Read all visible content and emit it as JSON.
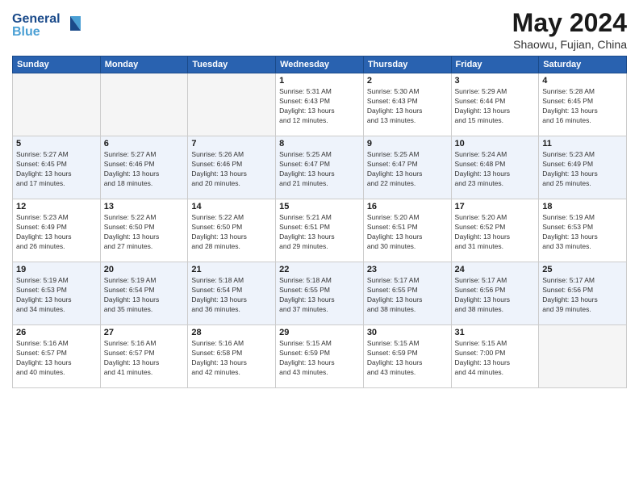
{
  "header": {
    "title": "May 2024",
    "location": "Shaowu, Fujian, China"
  },
  "calendar": {
    "headers": [
      "Sunday",
      "Monday",
      "Tuesday",
      "Wednesday",
      "Thursday",
      "Friday",
      "Saturday"
    ],
    "rows": [
      [
        {
          "day": "",
          "info": ""
        },
        {
          "day": "",
          "info": ""
        },
        {
          "day": "",
          "info": ""
        },
        {
          "day": "1",
          "info": "Sunrise: 5:31 AM\nSunset: 6:43 PM\nDaylight: 13 hours\nand 12 minutes."
        },
        {
          "day": "2",
          "info": "Sunrise: 5:30 AM\nSunset: 6:43 PM\nDaylight: 13 hours\nand 13 minutes."
        },
        {
          "day": "3",
          "info": "Sunrise: 5:29 AM\nSunset: 6:44 PM\nDaylight: 13 hours\nand 15 minutes."
        },
        {
          "day": "4",
          "info": "Sunrise: 5:28 AM\nSunset: 6:45 PM\nDaylight: 13 hours\nand 16 minutes."
        }
      ],
      [
        {
          "day": "5",
          "info": "Sunrise: 5:27 AM\nSunset: 6:45 PM\nDaylight: 13 hours\nand 17 minutes."
        },
        {
          "day": "6",
          "info": "Sunrise: 5:27 AM\nSunset: 6:46 PM\nDaylight: 13 hours\nand 18 minutes."
        },
        {
          "day": "7",
          "info": "Sunrise: 5:26 AM\nSunset: 6:46 PM\nDaylight: 13 hours\nand 20 minutes."
        },
        {
          "day": "8",
          "info": "Sunrise: 5:25 AM\nSunset: 6:47 PM\nDaylight: 13 hours\nand 21 minutes."
        },
        {
          "day": "9",
          "info": "Sunrise: 5:25 AM\nSunset: 6:47 PM\nDaylight: 13 hours\nand 22 minutes."
        },
        {
          "day": "10",
          "info": "Sunrise: 5:24 AM\nSunset: 6:48 PM\nDaylight: 13 hours\nand 23 minutes."
        },
        {
          "day": "11",
          "info": "Sunrise: 5:23 AM\nSunset: 6:49 PM\nDaylight: 13 hours\nand 25 minutes."
        }
      ],
      [
        {
          "day": "12",
          "info": "Sunrise: 5:23 AM\nSunset: 6:49 PM\nDaylight: 13 hours\nand 26 minutes."
        },
        {
          "day": "13",
          "info": "Sunrise: 5:22 AM\nSunset: 6:50 PM\nDaylight: 13 hours\nand 27 minutes."
        },
        {
          "day": "14",
          "info": "Sunrise: 5:22 AM\nSunset: 6:50 PM\nDaylight: 13 hours\nand 28 minutes."
        },
        {
          "day": "15",
          "info": "Sunrise: 5:21 AM\nSunset: 6:51 PM\nDaylight: 13 hours\nand 29 minutes."
        },
        {
          "day": "16",
          "info": "Sunrise: 5:20 AM\nSunset: 6:51 PM\nDaylight: 13 hours\nand 30 minutes."
        },
        {
          "day": "17",
          "info": "Sunrise: 5:20 AM\nSunset: 6:52 PM\nDaylight: 13 hours\nand 31 minutes."
        },
        {
          "day": "18",
          "info": "Sunrise: 5:19 AM\nSunset: 6:53 PM\nDaylight: 13 hours\nand 33 minutes."
        }
      ],
      [
        {
          "day": "19",
          "info": "Sunrise: 5:19 AM\nSunset: 6:53 PM\nDaylight: 13 hours\nand 34 minutes."
        },
        {
          "day": "20",
          "info": "Sunrise: 5:19 AM\nSunset: 6:54 PM\nDaylight: 13 hours\nand 35 minutes."
        },
        {
          "day": "21",
          "info": "Sunrise: 5:18 AM\nSunset: 6:54 PM\nDaylight: 13 hours\nand 36 minutes."
        },
        {
          "day": "22",
          "info": "Sunrise: 5:18 AM\nSunset: 6:55 PM\nDaylight: 13 hours\nand 37 minutes."
        },
        {
          "day": "23",
          "info": "Sunrise: 5:17 AM\nSunset: 6:55 PM\nDaylight: 13 hours\nand 38 minutes."
        },
        {
          "day": "24",
          "info": "Sunrise: 5:17 AM\nSunset: 6:56 PM\nDaylight: 13 hours\nand 38 minutes."
        },
        {
          "day": "25",
          "info": "Sunrise: 5:17 AM\nSunset: 6:56 PM\nDaylight: 13 hours\nand 39 minutes."
        }
      ],
      [
        {
          "day": "26",
          "info": "Sunrise: 5:16 AM\nSunset: 6:57 PM\nDaylight: 13 hours\nand 40 minutes."
        },
        {
          "day": "27",
          "info": "Sunrise: 5:16 AM\nSunset: 6:57 PM\nDaylight: 13 hours\nand 41 minutes."
        },
        {
          "day": "28",
          "info": "Sunrise: 5:16 AM\nSunset: 6:58 PM\nDaylight: 13 hours\nand 42 minutes."
        },
        {
          "day": "29",
          "info": "Sunrise: 5:15 AM\nSunset: 6:59 PM\nDaylight: 13 hours\nand 43 minutes."
        },
        {
          "day": "30",
          "info": "Sunrise: 5:15 AM\nSunset: 6:59 PM\nDaylight: 13 hours\nand 43 minutes."
        },
        {
          "day": "31",
          "info": "Sunrise: 5:15 AM\nSunset: 7:00 PM\nDaylight: 13 hours\nand 44 minutes."
        },
        {
          "day": "",
          "info": ""
        }
      ]
    ]
  }
}
